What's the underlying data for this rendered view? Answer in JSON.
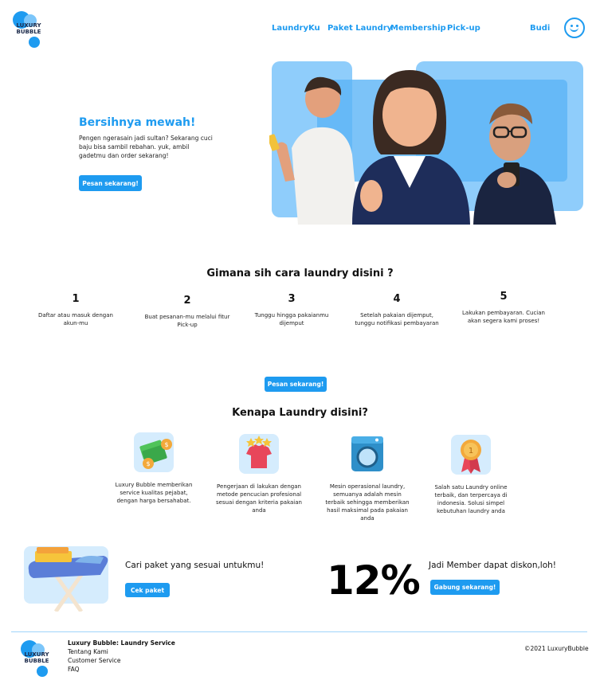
{
  "brand": {
    "line1": "LUXURY",
    "line2": "BUBBLE"
  },
  "nav": {
    "items": [
      "LaundryKu",
      "Paket Laundry",
      "Membership",
      "Pick-up"
    ],
    "user_name": "Budi",
    "avatar_icon": "smiley-face-icon"
  },
  "hero": {
    "title": "Bersihnya mewah!",
    "description": "Pengen ngerasain jadi sultan? Sekarang cuci baju bisa sambil rebahan. yuk, ambil gadetmu dan order sekarang!",
    "cta": "Pesan sekarang!"
  },
  "how": {
    "title": "Gimana sih cara laundry disini ?",
    "steps": [
      {
        "num": "1",
        "text": "Daftar atau masuk dengan akun-mu"
      },
      {
        "num": "2",
        "text": "Buat pesanan-mu melalui fitur Pick-up"
      },
      {
        "num": "3",
        "text": "Tunggu hingga pakaianmu dijemput"
      },
      {
        "num": "4",
        "text": "Setelah pakaian dijemput, tunggu notifikasi pembayaran"
      },
      {
        "num": "5",
        "text": "Lakukan pembayaran. Cucian akan segera kami proses!"
      }
    ],
    "cta": "Pesan sekarang!"
  },
  "why": {
    "title": "Kenapa Laundry disini?",
    "items": [
      {
        "icon": "money-icon",
        "text": "Luxury Bubble memberikan service kualitas pejabat, dengan harga bersahabat."
      },
      {
        "icon": "tshirt-stars-icon",
        "text": "Pengerjaan di lakukan dengan metode pencucian profesional sesuai dengan kriteria pakaian anda"
      },
      {
        "icon": "washing-machine-icon",
        "text": "Mesin operasional laundry, semuanya adalah mesin terbaik sehingga memberikan hasil maksimal pada pakaian anda"
      },
      {
        "icon": "medal-icon",
        "text": "Salah satu Laundry online terbaik, dan terpercaya di indonesia. Solusi simpel kebutuhan laundry anda"
      }
    ]
  },
  "packages": {
    "text": "Cari paket yang sesuai untukmu!",
    "cta": "Cek paket"
  },
  "membership": {
    "percent": "12%",
    "text": "Jadi Member dapat diskon,loh!",
    "cta": "Gabung sekarang!"
  },
  "footer": {
    "title": "Luxury Bubble: Laundry Service",
    "links": [
      "Tentang Kami",
      "Customer Service",
      "FAQ"
    ],
    "copyright": "©2021 LuxuryBubble"
  },
  "colors": {
    "accent": "#1e9bf0",
    "light_accent": "#8fcdfb",
    "text": "#111111"
  }
}
